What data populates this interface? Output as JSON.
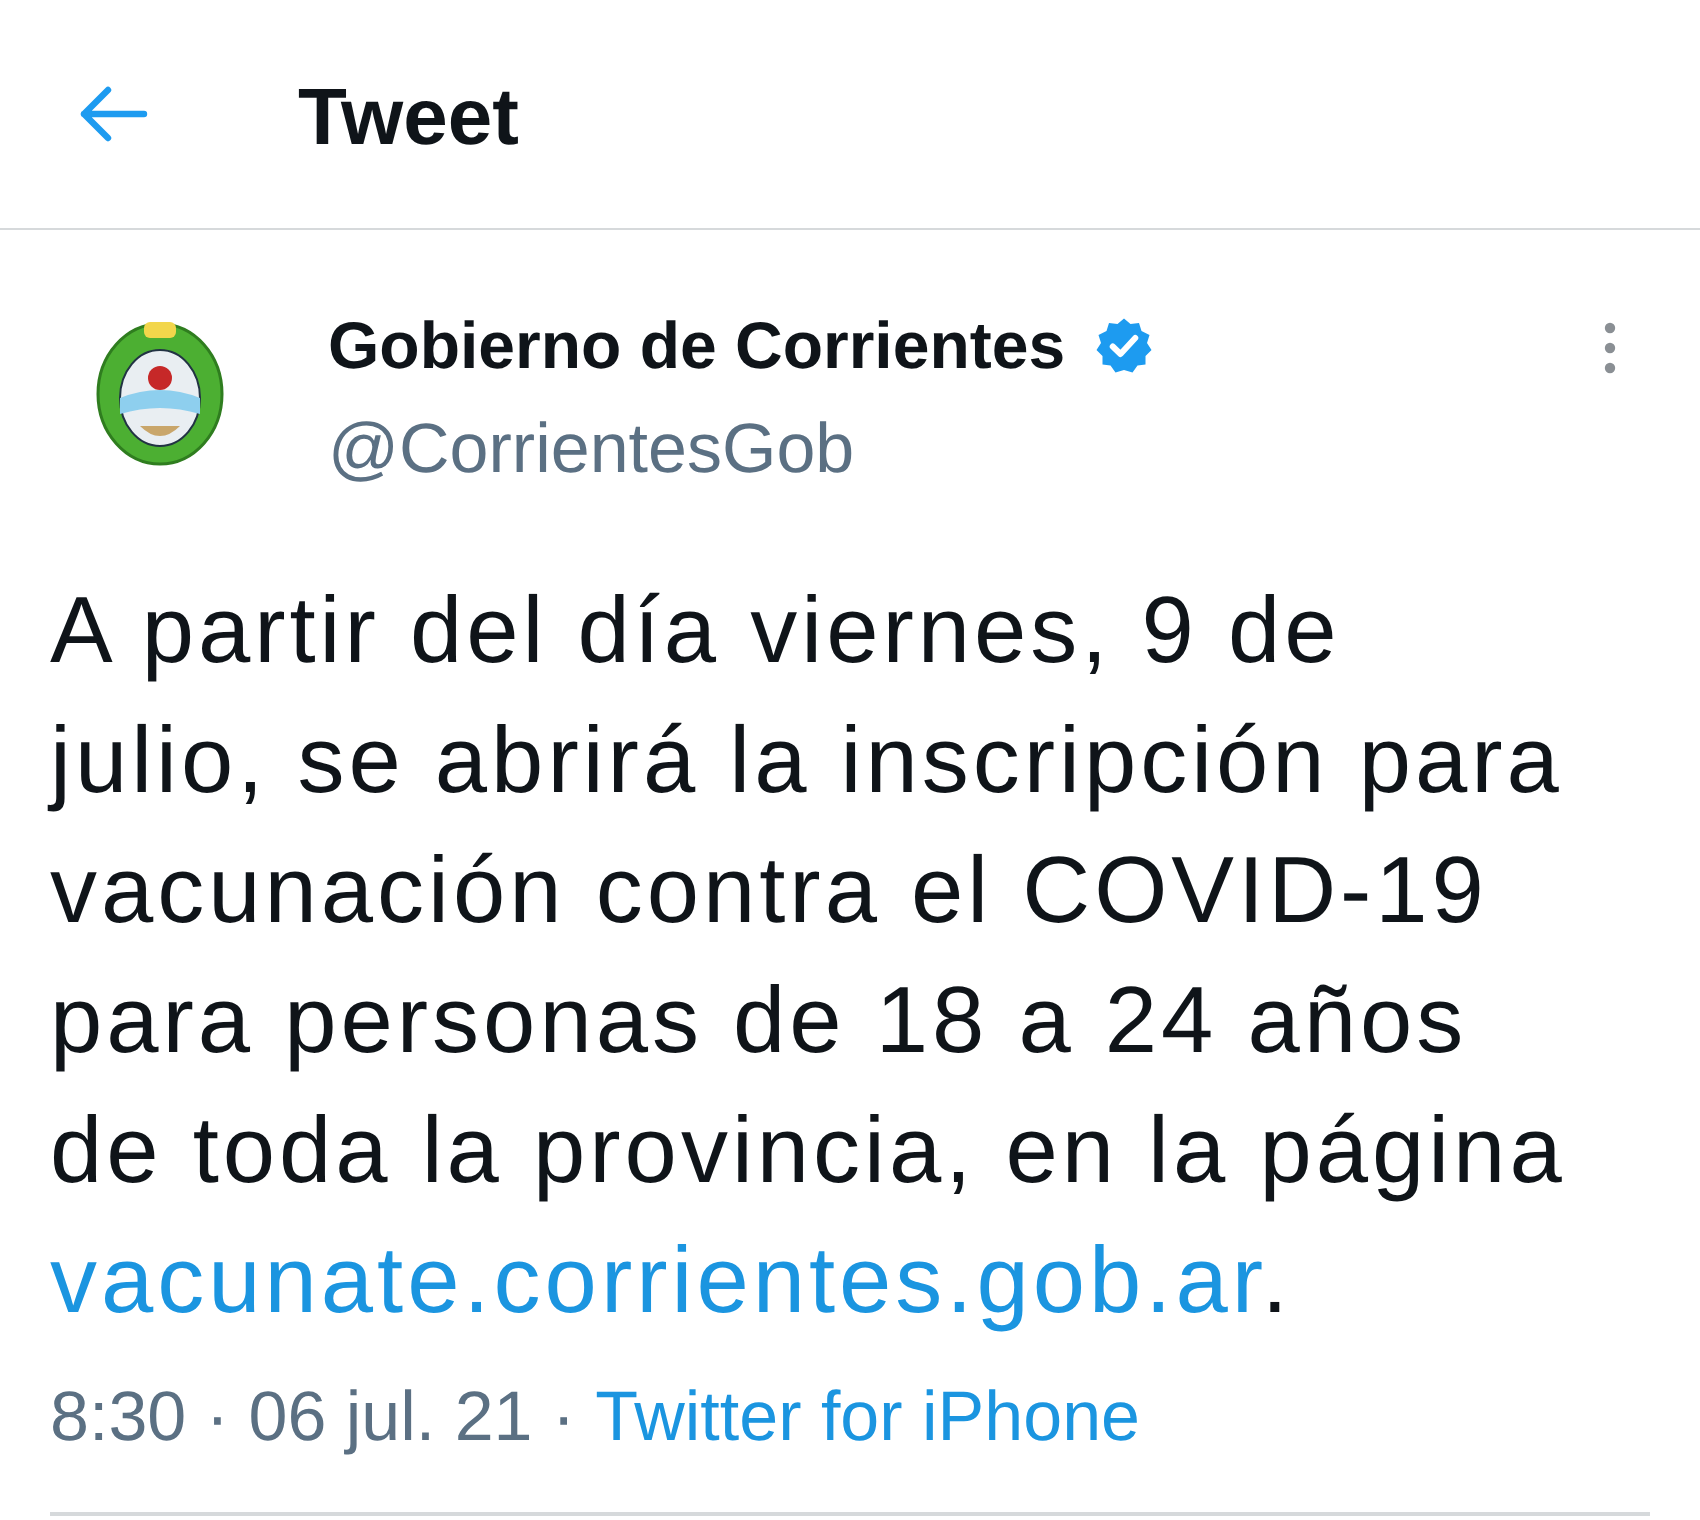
{
  "header": {
    "title": "Tweet"
  },
  "tweet": {
    "author": {
      "name": "Gobierno de Corrientes",
      "verified": true,
      "handle": "@CorrientesGob"
    },
    "body": {
      "text": "A partir del día viernes, 9 de julio, se abrirá la inscripción para vacunación contra el COVID-19 para personas de 18 a 24 años de toda la provincia, en la página ",
      "link": "vacunate.corrientes.gob.ar",
      "text_after": "."
    },
    "meta": {
      "time_and_date": "8:30 · 06 jul. 21 ·",
      "source": "Twitter for iPhone"
    }
  }
}
